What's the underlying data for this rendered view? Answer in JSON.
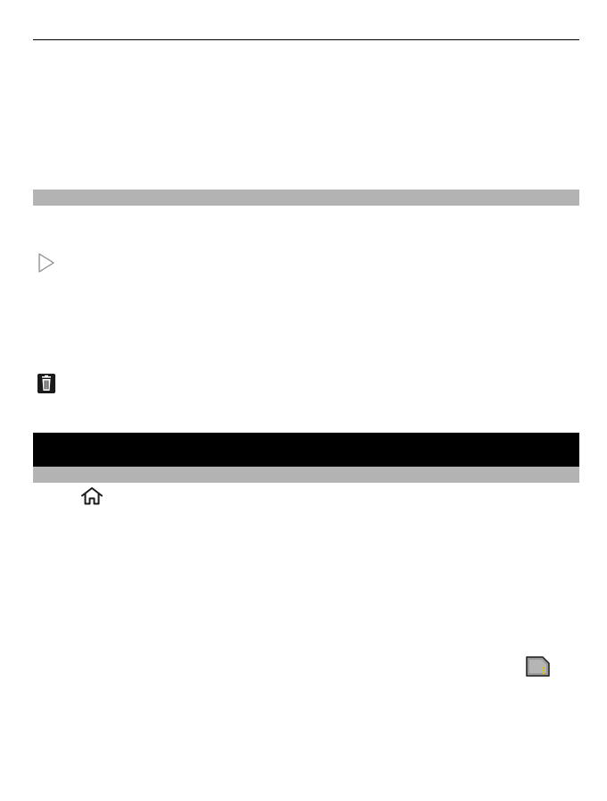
{
  "icons": {
    "play": "play-outline-icon",
    "trash": "trash-icon",
    "home": "home-icon",
    "memory_card": "memory-card-icon"
  },
  "colors": {
    "rule": "#000000",
    "band_gray": "#b3b3b3",
    "band_black": "#000000",
    "icon_dark": "#1a1a1a",
    "icon_yellow": "#d9c400"
  }
}
